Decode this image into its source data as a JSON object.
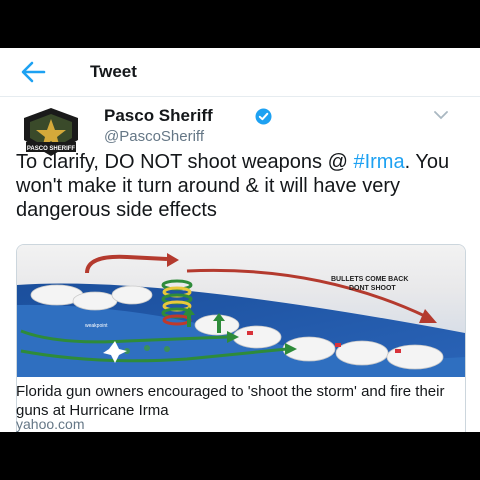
{
  "header": {
    "title": "Tweet",
    "back_icon": "arrow-left-icon"
  },
  "author": {
    "name": "Pasco Sheriff",
    "handle": "@PascoSheriff",
    "verified_icon": "verified-badge-icon",
    "badge_text": "PASCO SHERIFF"
  },
  "tweet": {
    "text_before": "To clarify, DO NOT shoot weapons @ ",
    "hashtag": "#Irma",
    "text_after": ". You won't make it turn around & it will have very dangerous side effects"
  },
  "card": {
    "title": "Florida gun owners encouraged to 'shoot the storm' and fire their guns at Hurricane Irma",
    "domain": "yahoo.com",
    "image": {
      "callout_line1": "BULLETS COME BACK",
      "callout_line2": "DONT SHOOT",
      "label_weakpoint": "weakpoint"
    }
  },
  "colors": {
    "link": "#1da1f2",
    "text": "#14171a",
    "muted": "#657786"
  }
}
